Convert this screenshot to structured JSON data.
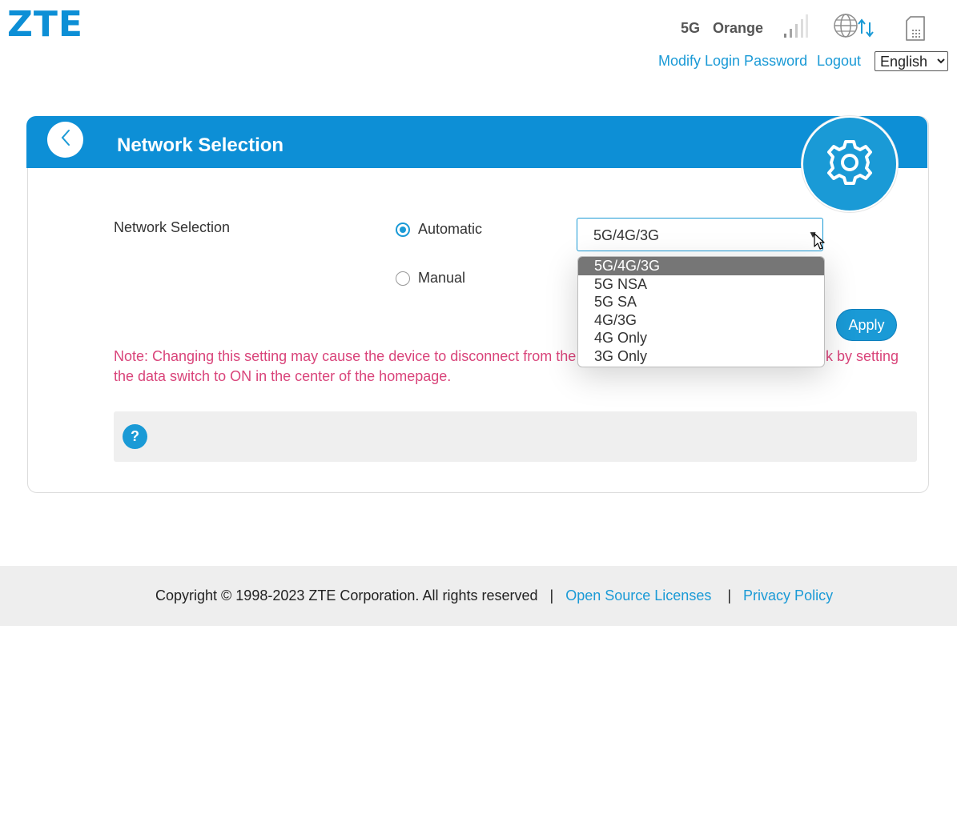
{
  "header": {
    "logo": "ZTE",
    "network_type": "5G",
    "carrier": "Orange",
    "icons": [
      "signal-bars-icon",
      "globe-data-icon",
      "sim-card-icon"
    ],
    "modify_password_label": "Modify Login Password",
    "logout_label": "Logout",
    "language": {
      "selected": "English"
    }
  },
  "card": {
    "title": "Network Selection",
    "field_label": "Network Selection",
    "radio_options": [
      {
        "label": "Automatic",
        "checked": true
      },
      {
        "label": "Manual",
        "checked": false
      }
    ],
    "mode_select": {
      "value": "5G/4G/3G",
      "options": [
        "5G/4G/3G",
        "5G NSA",
        "5G SA",
        "4G/3G",
        "4G Only",
        "3G Only"
      ],
      "highlighted": "5G/4G/3G"
    },
    "apply_label": "Apply",
    "note": "Note: Changing this setting may cause the device to disconnect from the ne",
    "note_right": "k by setting",
    "note_line2": "the data switch to ON in the center of the homepage.",
    "help_icon_glyph": "?"
  },
  "footer": {
    "copyright": "Copyright © 1998-2023 ZTE Corporation. All rights reserved",
    "separator": "|",
    "open_source_label": "Open Source Licenses",
    "privacy_label": "Privacy Policy"
  },
  "colors": {
    "accent": "#1a9ad6",
    "header_bar": "#0d8fd6",
    "note": "#d9447a",
    "dropdown_selected": "#767676"
  }
}
